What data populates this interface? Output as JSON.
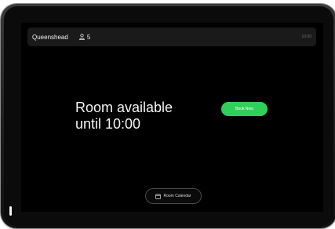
{
  "header": {
    "room_name": "Queenshead",
    "capacity": "5",
    "capacity_icon": "person-icon",
    "clock": "10:00"
  },
  "main": {
    "status_line1": "Room available",
    "status_line2": "until 10:00",
    "book_button_label": "Book Now",
    "calendar_button_label": "Room Calendar",
    "calendar_icon": "calendar-icon"
  },
  "colors": {
    "accent": "#2fd05a",
    "screen_background": "#000000",
    "topbar_background": "#1a1a1a"
  }
}
